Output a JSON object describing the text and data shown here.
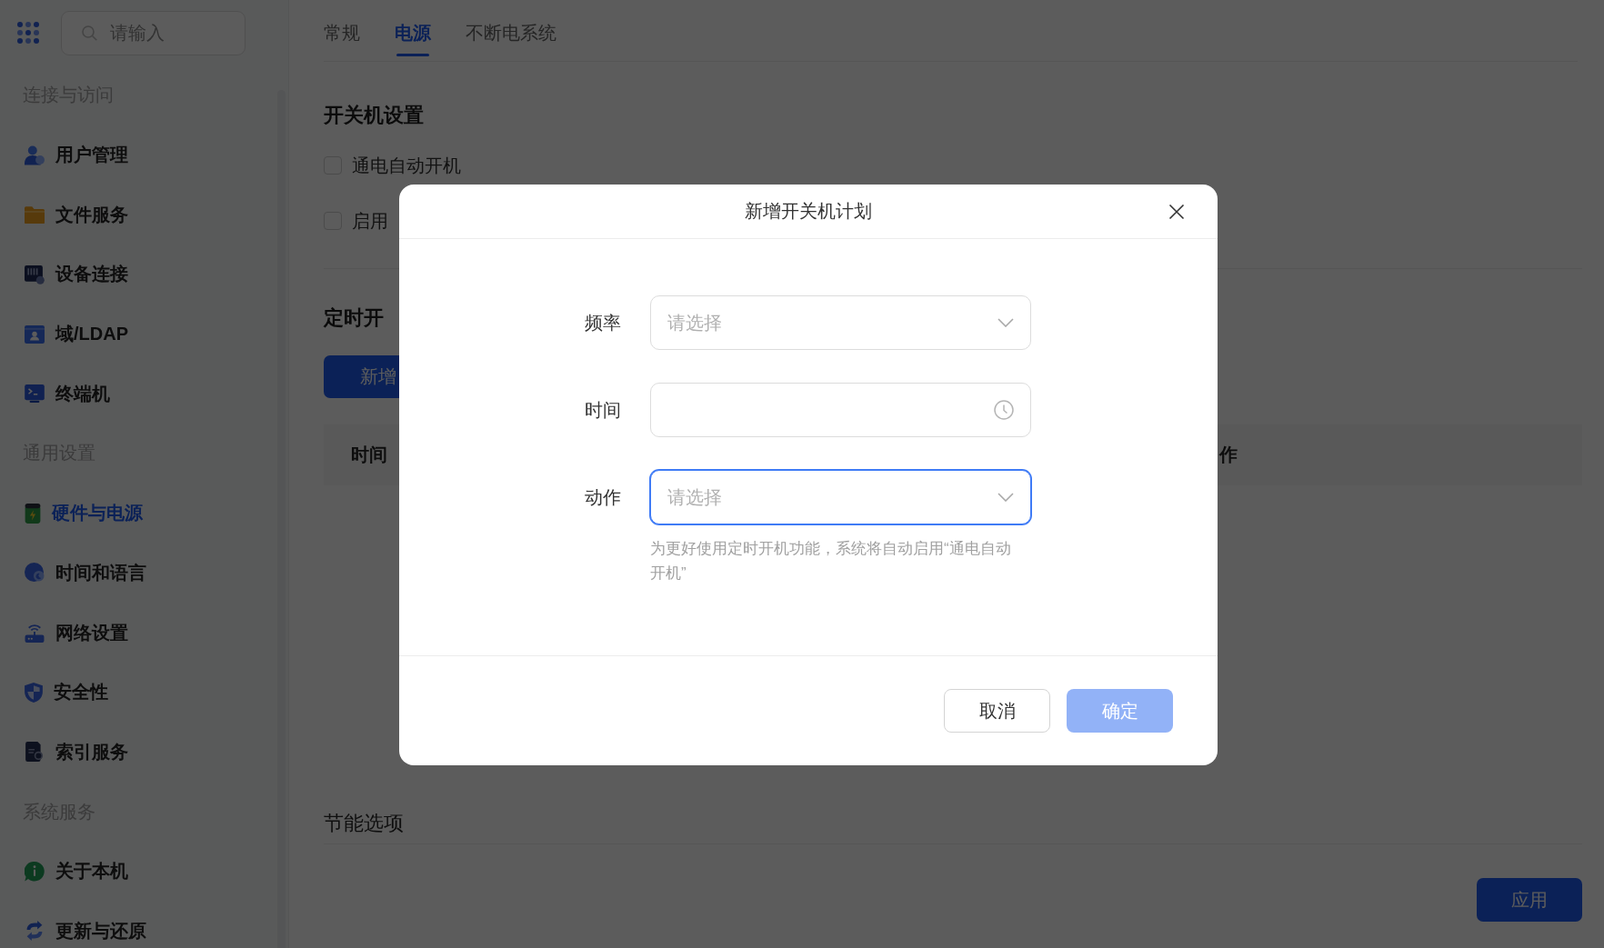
{
  "sidebar": {
    "search": {
      "placeholder": "请输入"
    },
    "groups": [
      {
        "title": "连接与访问",
        "items": [
          {
            "label": "用户管理",
            "selected": false
          },
          {
            "label": "文件服务",
            "selected": false
          },
          {
            "label": "设备连接",
            "selected": false
          },
          {
            "label": "域/LDAP",
            "selected": false
          },
          {
            "label": "终端机",
            "selected": false
          }
        ]
      },
      {
        "title": "通用设置",
        "items": [
          {
            "label": "硬件与电源",
            "selected": true
          },
          {
            "label": "时间和语言",
            "selected": false
          },
          {
            "label": "网络设置",
            "selected": false
          },
          {
            "label": "安全性",
            "selected": false
          },
          {
            "label": "索引服务",
            "selected": false
          }
        ]
      },
      {
        "title": "系统服务",
        "items": [
          {
            "label": "关于本机",
            "selected": false
          },
          {
            "label": "更新与还原",
            "selected": false
          }
        ]
      }
    ]
  },
  "tabs": [
    {
      "label": "常规",
      "selected": false
    },
    {
      "label": "电源",
      "selected": true
    },
    {
      "label": "不断电系统",
      "selected": false
    }
  ],
  "power_settings": {
    "title": "开关机设置",
    "options": [
      {
        "label": "通电自动开机",
        "checked": false
      },
      {
        "label": "启用",
        "checked": false
      }
    ]
  },
  "schedule": {
    "title": "定时开",
    "add_button": "新增",
    "table": {
      "columns": [
        "时间",
        "作"
      ]
    }
  },
  "energy_options": {
    "title": "节能选项"
  },
  "apply_button": "应用",
  "dialog": {
    "title": "新增开关机计划",
    "fields": [
      {
        "label": "频率",
        "kind": "select",
        "placeholder": "请选择",
        "focused": false
      },
      {
        "label": "时间",
        "kind": "time",
        "focused": false
      },
      {
        "label": "动作",
        "kind": "select",
        "placeholder": "请选择",
        "focused": true,
        "hint": "为更好使用定时开机功能，系统将自动启用“通电自动开机”"
      }
    ],
    "buttons": [
      {
        "label": "取消",
        "kind": "secondary",
        "disabled": false
      },
      {
        "label": "确定",
        "kind": "primary",
        "disabled": true
      }
    ]
  }
}
